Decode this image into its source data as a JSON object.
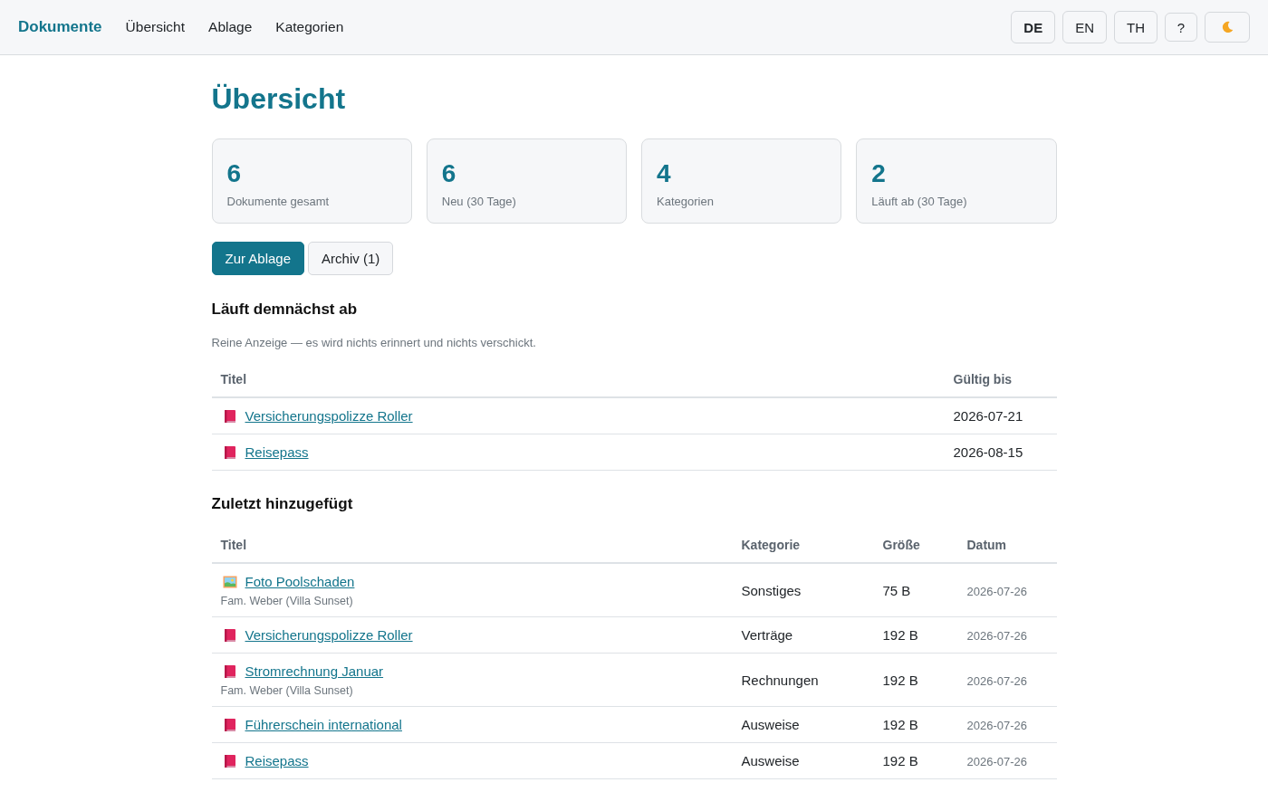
{
  "nav": {
    "brand": "Dokumente",
    "links": [
      "Übersicht",
      "Ablage",
      "Kategorien"
    ]
  },
  "languages": [
    {
      "label": "DE",
      "selected": true
    },
    {
      "label": "EN",
      "selected": false
    },
    {
      "label": "TH",
      "selected": false
    }
  ],
  "help_button": "?",
  "page_title": "Übersicht",
  "stats": [
    {
      "value": "6",
      "label": "Dokumente gesamt"
    },
    {
      "value": "6",
      "label": "Neu (30 Tage)"
    },
    {
      "value": "4",
      "label": "Kategorien"
    },
    {
      "value": "2",
      "label": "Läuft ab (30 Tage)"
    }
  ],
  "actions": [
    {
      "label": "Zur Ablage",
      "primary": true
    },
    {
      "label": "Archiv (1)",
      "primary": false
    }
  ],
  "expiring": {
    "heading": "Läuft demnächst ab",
    "note": "Reine Anzeige — es wird nichts erinnert und nichts verschickt.",
    "columns": [
      "Titel",
      "Gültig bis"
    ],
    "rows": [
      {
        "kind": "document",
        "title": "Versicherungspolizze Roller",
        "valid_until": "2026-07-21"
      },
      {
        "kind": "document",
        "title": "Reisepass",
        "valid_until": "2026-08-15"
      }
    ]
  },
  "recent": {
    "heading": "Zuletzt hinzugefügt",
    "columns": [
      "Titel",
      "Kategorie",
      "Größe",
      "Datum"
    ],
    "rows": [
      {
        "kind": "image",
        "title": "Foto Poolschaden",
        "owner": "Fam. Weber (Villa Sunset)",
        "category": "Sonstiges",
        "size": "75 B",
        "date": "2026-07-26"
      },
      {
        "kind": "document",
        "title": "Versicherungspolizze Roller",
        "category": "Verträge",
        "size": "192 B",
        "date": "2026-07-26"
      },
      {
        "kind": "document",
        "title": "Stromrechnung Januar",
        "owner": "Fam. Weber (Villa Sunset)",
        "category": "Rechnungen",
        "size": "192 B",
        "date": "2026-07-26"
      },
      {
        "kind": "document",
        "title": "Führerschein international",
        "category": "Ausweise",
        "size": "192 B",
        "date": "2026-07-26"
      },
      {
        "kind": "document",
        "title": "Reisepass",
        "category": "Ausweise",
        "size": "192 B",
        "date": "2026-07-26"
      }
    ]
  }
}
